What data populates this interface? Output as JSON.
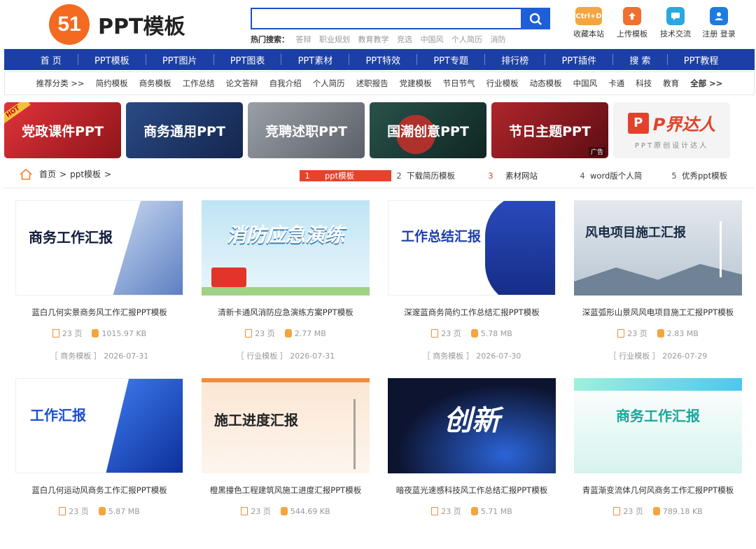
{
  "header": {
    "logo_mark": "51",
    "logo_text": "PPT模板",
    "search_placeholder": "",
    "hot_label": "热门搜索：",
    "hot_terms": [
      "答辩",
      "职业规划",
      "教育教学",
      "竞选",
      "中国风",
      "个人简历",
      "消防"
    ],
    "tools": [
      {
        "label": "收藏本站",
        "icon": "bookmark-icon",
        "badge": "Ctrl+D",
        "color": "#f5a540"
      },
      {
        "label": "上传模板",
        "icon": "upload-icon",
        "badge": "",
        "color": "#f07030"
      },
      {
        "label": "技术交流",
        "icon": "chat-icon",
        "badge": "",
        "color": "#2aa8e0"
      },
      {
        "label": "注册 登录",
        "icon": "user-icon",
        "badge": "",
        "color": "#1e7be0"
      }
    ]
  },
  "nav": [
    "首 页",
    "PPT模板",
    "PPT图片",
    "PPT图表",
    "PPT素材",
    "PPT特效",
    "PPT专题",
    "排行榜",
    "PPT插件",
    "搜 索",
    "PPT教程"
  ],
  "categories": {
    "lead": "推荐分类 >>",
    "items": [
      "简约模板",
      "商务模板",
      "工作总结",
      "论文答辩",
      "自我介绍",
      "个人简历",
      "述职报告",
      "党建模板",
      "节日节气",
      "行业模板",
      "动态模板",
      "中国风",
      "卡通",
      "科技",
      "教育"
    ],
    "all": "全部 >>"
  },
  "banners": [
    {
      "text": "党政课件PPT",
      "badge": "HOT",
      "bg": "#c8242a"
    },
    {
      "text": "商务通用PPT",
      "badge": "",
      "bg": "#1f3567"
    },
    {
      "text": "竞聘述职PPT",
      "badge": "",
      "bg": "#7a7e86"
    },
    {
      "text": "国潮创意PPT",
      "badge": "",
      "bg": "#1f3e38"
    },
    {
      "text": "节日主题PPT",
      "badge": "广告",
      "bg": "#8c1a1f"
    },
    {
      "text": "P界达人",
      "sub": "PPT原创设计达人",
      "badge": "",
      "bg": "#f4f4f4"
    }
  ],
  "breadcrumb": {
    "home": "首页",
    "sep": ">",
    "current": "ppt模板",
    "tail": ">"
  },
  "ranking": [
    {
      "n": "1",
      "label": "ppt模板"
    },
    {
      "n": "2",
      "label": "下载简历模板"
    },
    {
      "n": "3",
      "label": "素材网站"
    },
    {
      "n": "4",
      "label": "word版个人简"
    },
    {
      "n": "5",
      "label": "优秀ppt模板"
    }
  ],
  "cards": [
    {
      "title": "蓝白几何实景商务风工作汇报PPT模板",
      "pages": "23 页",
      "size": "1015.97 KB",
      "tag": "［ 商务模板 ］",
      "date": "2026-07-31",
      "thumb_text": "商务工作汇报",
      "thumb_bg": "#ffffff",
      "thumb_fg": "#111c3a"
    },
    {
      "title": "清新卡通风消防应急演练方案PPT模板",
      "pages": "23 页",
      "size": "2.77 MB",
      "tag": "［ 行业模板 ］",
      "date": "2026-07-31",
      "thumb_text": "消防应急演练",
      "thumb_bg": "#bfe3f2",
      "thumb_fg": "#ffffff"
    },
    {
      "title": "深邃蓝商务简约工作总结汇报PPT模板",
      "pages": "23 页",
      "size": "5.78 MB",
      "tag": "［ 商务模板 ］",
      "date": "2026-07-30",
      "thumb_text": "工作总结汇报",
      "thumb_bg": "#ffffff",
      "thumb_fg": "#1d3fa8"
    },
    {
      "title": "深蓝弧形山景风风电项目施工汇报PPT模板",
      "pages": "23 页",
      "size": "2.83 MB",
      "tag": "［ 行业模板 ］",
      "date": "2026-07-29",
      "thumb_text": "风电项目施工汇报",
      "thumb_bg": "#dfe5ea",
      "thumb_fg": "#1b2b45"
    },
    {
      "title": "蓝白几何运动风商务工作汇报PPT模板",
      "pages": "23 页",
      "size": "5.87 MB",
      "tag": "",
      "date": "",
      "thumb_text": "工作汇报",
      "thumb_bg": "#ffffff",
      "thumb_fg": "#1d4fd0"
    },
    {
      "title": "橙黑撞色工程建筑风施工进度汇报PPT模板",
      "pages": "23 页",
      "size": "544.69 KB",
      "tag": "",
      "date": "",
      "thumb_text": "施工进度汇报",
      "thumb_bg": "#fbeee2",
      "thumb_fg": "#222222"
    },
    {
      "title": "暗夜蓝光速感科技风工作总结汇报PPT模板",
      "pages": "23 页",
      "size": "5.71 MB",
      "tag": "",
      "date": "",
      "thumb_text": "创新",
      "thumb_bg": "#0d1430",
      "thumb_fg": "#ffffff"
    },
    {
      "title": "青蓝渐变流体几何风商务工作汇报PPT模板",
      "pages": "23 页",
      "size": "789.18 KB",
      "tag": "",
      "date": "",
      "thumb_text": "商务工作汇报",
      "thumb_bg": "#dff6f2",
      "thumb_fg": "#1aa79a"
    }
  ]
}
